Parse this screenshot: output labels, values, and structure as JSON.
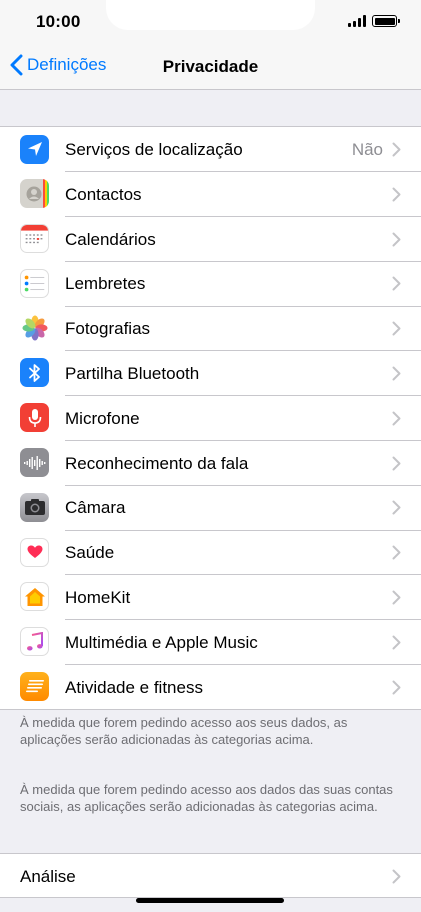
{
  "status_bar": {
    "time": "10:00"
  },
  "nav": {
    "back_label": "Definições",
    "title": "Privacidade"
  },
  "items": [
    {
      "label": "Serviços de localização",
      "value": "Não",
      "icon": "location-arrow-icon",
      "color": "#1a82fb"
    },
    {
      "label": "Contactos",
      "value": "",
      "icon": "contacts-icon",
      "color": "#d5d3cd"
    },
    {
      "label": "Calendários",
      "value": "",
      "icon": "calendar-icon",
      "color": "#ffffff"
    },
    {
      "label": "Lembretes",
      "value": "",
      "icon": "reminders-icon",
      "color": "#ffffff"
    },
    {
      "label": "Fotografias",
      "value": "",
      "icon": "photos-flower-icon",
      "color": "#ffffff"
    },
    {
      "label": "Partilha Bluetooth",
      "value": "",
      "icon": "bluetooth-icon",
      "color": "#1a82fb"
    },
    {
      "label": "Microfone",
      "value": "",
      "icon": "microphone-icon",
      "color": "#f23f35"
    },
    {
      "label": "Reconhecimento da fala",
      "value": "",
      "icon": "waveform-icon",
      "color": "#8e8e93"
    },
    {
      "label": "Câmara",
      "value": "",
      "icon": "camera-icon",
      "color": "#8e8e93"
    },
    {
      "label": "Saúde",
      "value": "",
      "icon": "heart-icon",
      "color": "#ffffff"
    },
    {
      "label": "HomeKit",
      "value": "",
      "icon": "home-icon",
      "color": "#ffffff"
    },
    {
      "label": "Multimédia e Apple Music",
      "value": "",
      "icon": "music-note-icon",
      "color": "#ffffff"
    },
    {
      "label": "Atividade e fitness",
      "value": "",
      "icon": "fitness-lines-icon",
      "color": "#ff9500"
    }
  ],
  "notes": {
    "note1": "À medida que forem pedindo acesso aos seus dados, as aplicações serão adicionadas às categorias acima.",
    "note2": "À medida que forem pedindo acesso aos dados das suas contas sociais, as aplicações serão adicionadas às categorias acima."
  },
  "analysis": {
    "label": "Análise"
  },
  "colors": {
    "accent": "#007aff",
    "separator": "#c8c7cc",
    "background": "#efeff4"
  }
}
